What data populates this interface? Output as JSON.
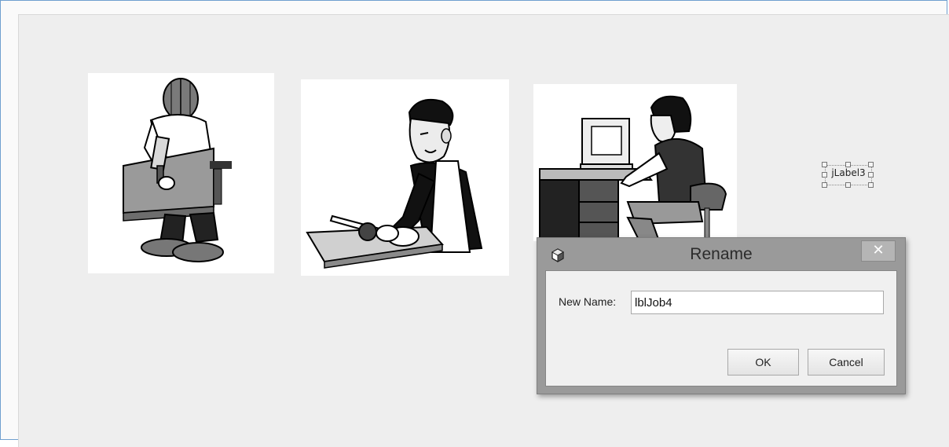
{
  "canvas": {
    "images": [
      {
        "icon": "worker-with-drill-image"
      },
      {
        "icon": "chef-cutting-image"
      },
      {
        "icon": "man-at-computer-image"
      }
    ],
    "label_component": {
      "text": "jLabel3"
    }
  },
  "dialog": {
    "title": "Rename",
    "close_glyph": "✕",
    "field_label": "New Name:",
    "field_value": "lblJob4",
    "ok_label": "OK",
    "cancel_label": "Cancel"
  }
}
